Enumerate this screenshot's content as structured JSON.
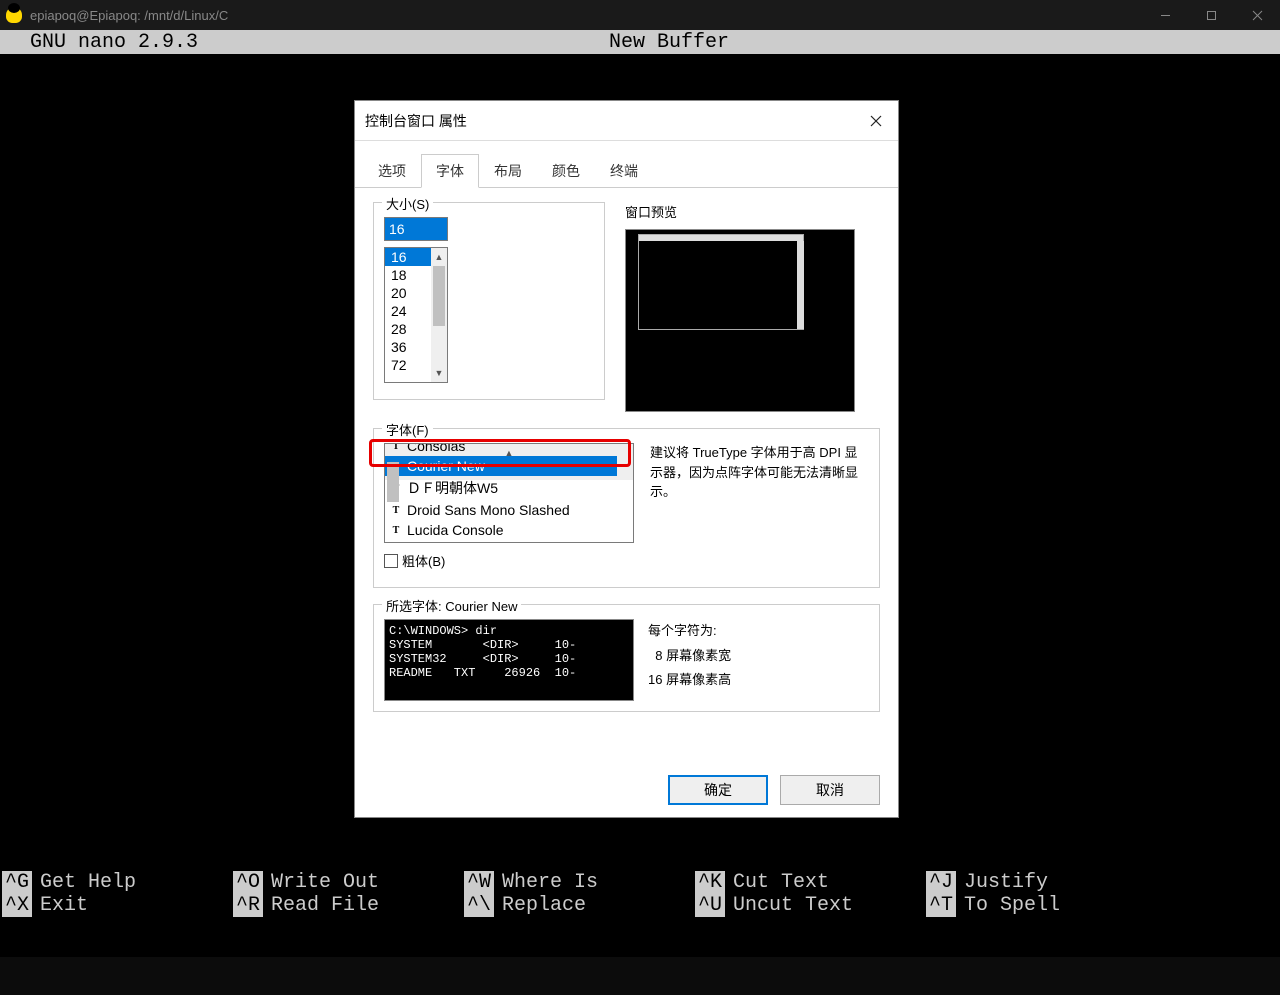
{
  "titlebar": {
    "title": "epiapoq@Epiapoq: /mnt/d/Linux/C"
  },
  "nano": {
    "version": "GNU  nano  2.9.3",
    "buffer": "New Buffer",
    "shortcuts": [
      [
        {
          "k": "^G",
          "l": "Get Help"
        },
        {
          "k": "^O",
          "l": "Write Out"
        },
        {
          "k": "^W",
          "l": "Where Is"
        },
        {
          "k": "^K",
          "l": "Cut Text"
        },
        {
          "k": "^J",
          "l": "Justify"
        }
      ],
      [
        {
          "k": "^X",
          "l": "Exit"
        },
        {
          "k": "^R",
          "l": "Read File"
        },
        {
          "k": "^\\",
          "l": "Replace"
        },
        {
          "k": "^U",
          "l": "Uncut Text"
        },
        {
          "k": "^T",
          "l": "To Spell"
        }
      ]
    ]
  },
  "dialog": {
    "title": "控制台窗口 属性",
    "tabs": [
      "选项",
      "字体",
      "布局",
      "颜色",
      "终端"
    ],
    "active_tab": "字体",
    "size_label": "大小(S)",
    "size_value": "16",
    "size_options": [
      "16",
      "18",
      "20",
      "24",
      "28",
      "36",
      "72"
    ],
    "preview_label": "窗口预览",
    "font_label": "字体(F)",
    "font_options": [
      "Consolas",
      "Courier New",
      "ＤＦ明朝体W5",
      "Droid Sans Mono Slashed",
      "Lucida Console"
    ],
    "font_selected": "Courier New",
    "hint": "建议将 TrueType 字体用于高 DPI 显示器，因为点阵字体可能无法清晰显示。",
    "bold_label": "粗体(B)",
    "sample_label_prefix": "所选字体: ",
    "sample_font": "Courier New",
    "sample_lines": [
      "C:\\WINDOWS> dir",
      "SYSTEM       <DIR>     10-",
      "SYSTEM32     <DIR>     10-",
      "README   TXT    26926  10-"
    ],
    "char_title": "每个字符为:",
    "char_w_val": "8",
    "char_w_lbl": "屏幕像素宽",
    "char_h_val": "16",
    "char_h_lbl": "屏幕像素高",
    "ok": "确定",
    "cancel": "取消"
  }
}
